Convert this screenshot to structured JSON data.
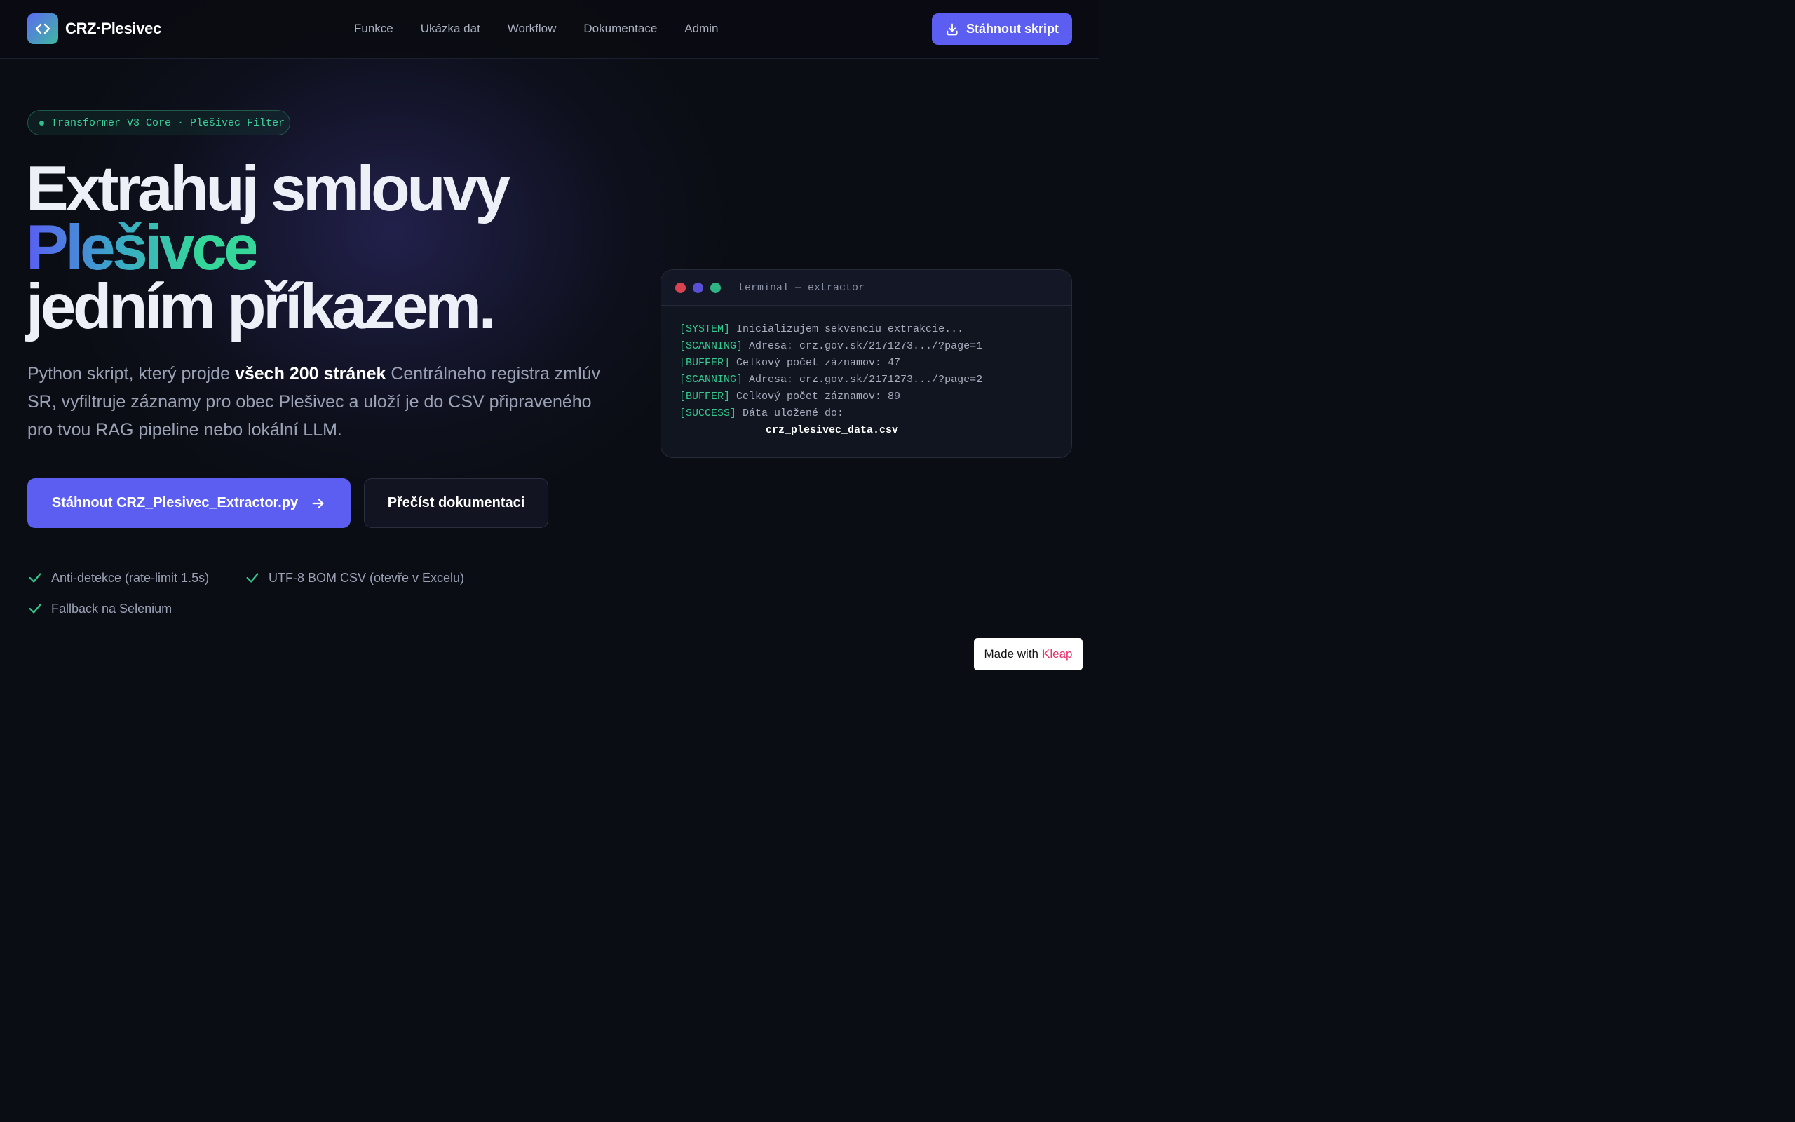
{
  "header": {
    "brand": "CRZ·Plesivec",
    "nav": [
      "Funkce",
      "Ukázka dat",
      "Workflow",
      "Dokumentace",
      "Admin"
    ],
    "download_label": "Stáhnout skript"
  },
  "hero": {
    "badge": "Transformer V3 Core · Plešivec Filter",
    "headline_line1": "Extrahuj smlouvy",
    "headline_line2": "Plešivce",
    "headline_line3": "jedním příkazem.",
    "sub_before": "Python skript, který projde ",
    "sub_bold": "všech 200 stránek",
    "sub_after": " Centrálneho registra zmlúv SR, vyfiltruje záznamy pro obec Plešivec a uloží je do CSV připraveného pro tvou RAG pipeline nebo lokální LLM.",
    "primary_button": "Stáhnout CRZ_Plesivec_Extractor.py",
    "secondary_button": "Přečíst dokumentaci",
    "features": [
      "Anti-detekce (rate-limit 1.5s)",
      "UTF-8 BOM CSV (otevře v Excelu)",
      "Fallback na Selenium"
    ]
  },
  "terminal": {
    "title": "terminal — extractor",
    "lines": [
      {
        "tag": "[SYSTEM]",
        "text": " Inicializujem sekvenciu extrakcie..."
      },
      {
        "tag": "[SCANNING]",
        "text": " Adresa: crz.gov.sk/2171273.../?page=1"
      },
      {
        "tag": "[BUFFER]",
        "text": " Celkový počet záznamov: 47"
      },
      {
        "tag": "[SCANNING]",
        "text": " Adresa: crz.gov.sk/2171273.../?page=2"
      },
      {
        "tag": "[BUFFER]",
        "text": " Celkový počet záznamov: 89"
      },
      {
        "tag": "[SUCCESS]",
        "text": " Dáta uložené do:"
      }
    ],
    "file": "crz_plesivec_data.csv"
  },
  "footer_badge": {
    "prefix": "Made with",
    "brand": "Kleap"
  },
  "colors": {
    "accent": "#5b5ef0",
    "green": "#34c98e",
    "background": "#0b0d14"
  }
}
